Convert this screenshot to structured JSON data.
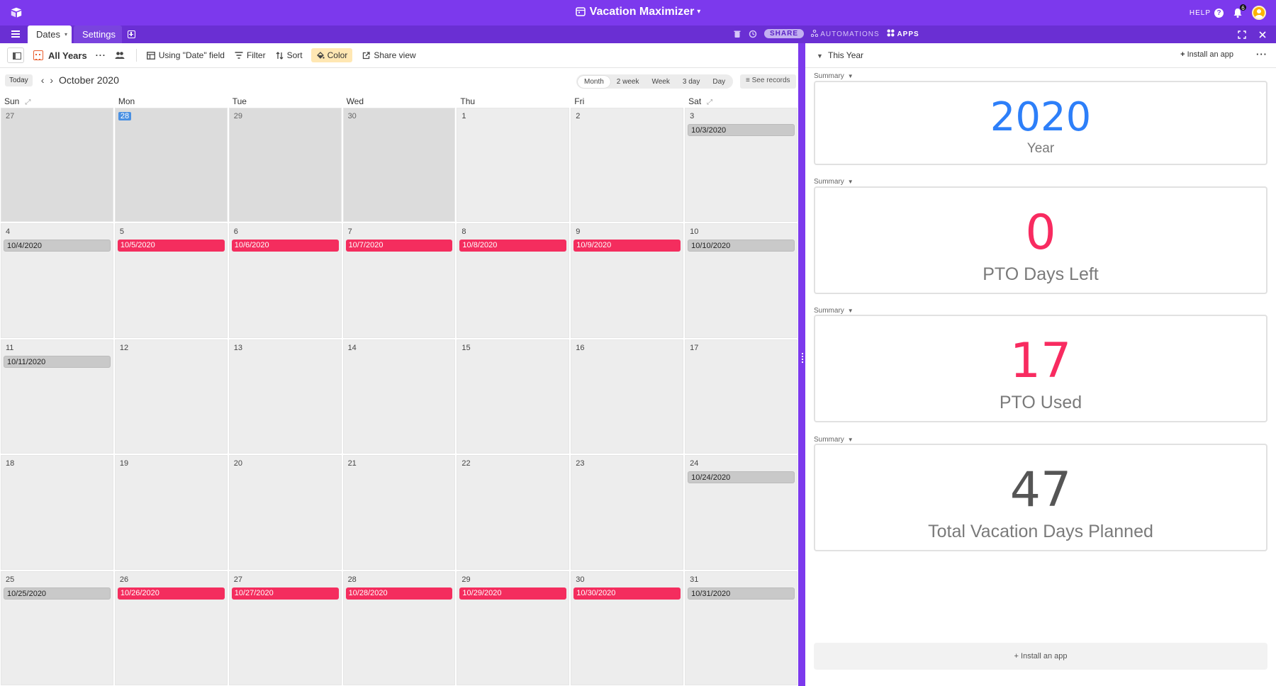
{
  "header": {
    "title": "Vacation Maximizer",
    "help_label": "HELP",
    "notification_count": "6"
  },
  "tabs": {
    "active_label": "Dates",
    "settings_label": "Settings"
  },
  "toolbar_right": {
    "share_label": "SHARE",
    "automations_label": "AUTOMATIONS",
    "apps_label": "APPS"
  },
  "view_bar": {
    "view_name": "All Years",
    "date_field_label": "Using \"Date\" field",
    "filter_label": "Filter",
    "sort_label": "Sort",
    "color_label": "Color",
    "share_view_label": "Share view"
  },
  "calendar": {
    "today_label": "Today",
    "month_label": "October 2020",
    "ranges": [
      "Month",
      "2 week",
      "Week",
      "3 day",
      "Day"
    ],
    "active_range": "Month",
    "see_records_label": "See records",
    "weekdays": [
      "Sun",
      "Mon",
      "Tue",
      "Wed",
      "Thu",
      "Fri",
      "Sat"
    ],
    "weeks": [
      [
        {
          "day": "27",
          "other": true
        },
        {
          "day": "28",
          "other": true,
          "today": true
        },
        {
          "day": "29",
          "other": true
        },
        {
          "day": "30",
          "other": true
        },
        {
          "day": "1"
        },
        {
          "day": "2"
        },
        {
          "day": "3",
          "event": "10/3/2020",
          "color": "gray"
        }
      ],
      [
        {
          "day": "4",
          "event": "10/4/2020",
          "color": "gray"
        },
        {
          "day": "5",
          "event": "10/5/2020",
          "color": "red"
        },
        {
          "day": "6",
          "event": "10/6/2020",
          "color": "red"
        },
        {
          "day": "7",
          "event": "10/7/2020",
          "color": "red"
        },
        {
          "day": "8",
          "event": "10/8/2020",
          "color": "red"
        },
        {
          "day": "9",
          "event": "10/9/2020",
          "color": "red"
        },
        {
          "day": "10",
          "event": "10/10/2020",
          "color": "gray"
        }
      ],
      [
        {
          "day": "11",
          "event": "10/11/2020",
          "color": "gray"
        },
        {
          "day": "12"
        },
        {
          "day": "13"
        },
        {
          "day": "14"
        },
        {
          "day": "15"
        },
        {
          "day": "16"
        },
        {
          "day": "17"
        }
      ],
      [
        {
          "day": "18"
        },
        {
          "day": "19"
        },
        {
          "day": "20"
        },
        {
          "day": "21"
        },
        {
          "day": "22"
        },
        {
          "day": "23"
        },
        {
          "day": "24",
          "event": "10/24/2020",
          "color": "gray"
        }
      ],
      [
        {
          "day": "25",
          "event": "10/25/2020",
          "color": "gray"
        },
        {
          "day": "26",
          "event": "10/26/2020",
          "color": "red"
        },
        {
          "day": "27",
          "event": "10/27/2020",
          "color": "red"
        },
        {
          "day": "28",
          "event": "10/28/2020",
          "color": "red"
        },
        {
          "day": "29",
          "event": "10/29/2020",
          "color": "red"
        },
        {
          "day": "30",
          "event": "10/30/2020",
          "color": "red"
        },
        {
          "day": "31",
          "event": "10/31/2020",
          "color": "gray"
        }
      ]
    ]
  },
  "apps_panel": {
    "dashboard_name": "This Year",
    "install_label": "Install an app",
    "footer_install_label": "Install an app",
    "summaries": [
      {
        "label": "Summary",
        "value": "2020",
        "caption": "Year",
        "color": "#2d7ff9"
      },
      {
        "label": "Summary",
        "value": "0",
        "caption": "PTO Days Left",
        "color": "#f82b60"
      },
      {
        "label": "Summary",
        "value": "17",
        "caption": "PTO Used",
        "color": "#f82b60"
      },
      {
        "label": "Summary",
        "value": "47",
        "caption": "Total Vacation Days Planned",
        "color": "#555555"
      }
    ]
  },
  "colors": {
    "brand_purple": "#7c39ed",
    "event_red": "#f42d5e",
    "event_gray": "#c9c9c9",
    "today_blue": "#4a90e2"
  }
}
